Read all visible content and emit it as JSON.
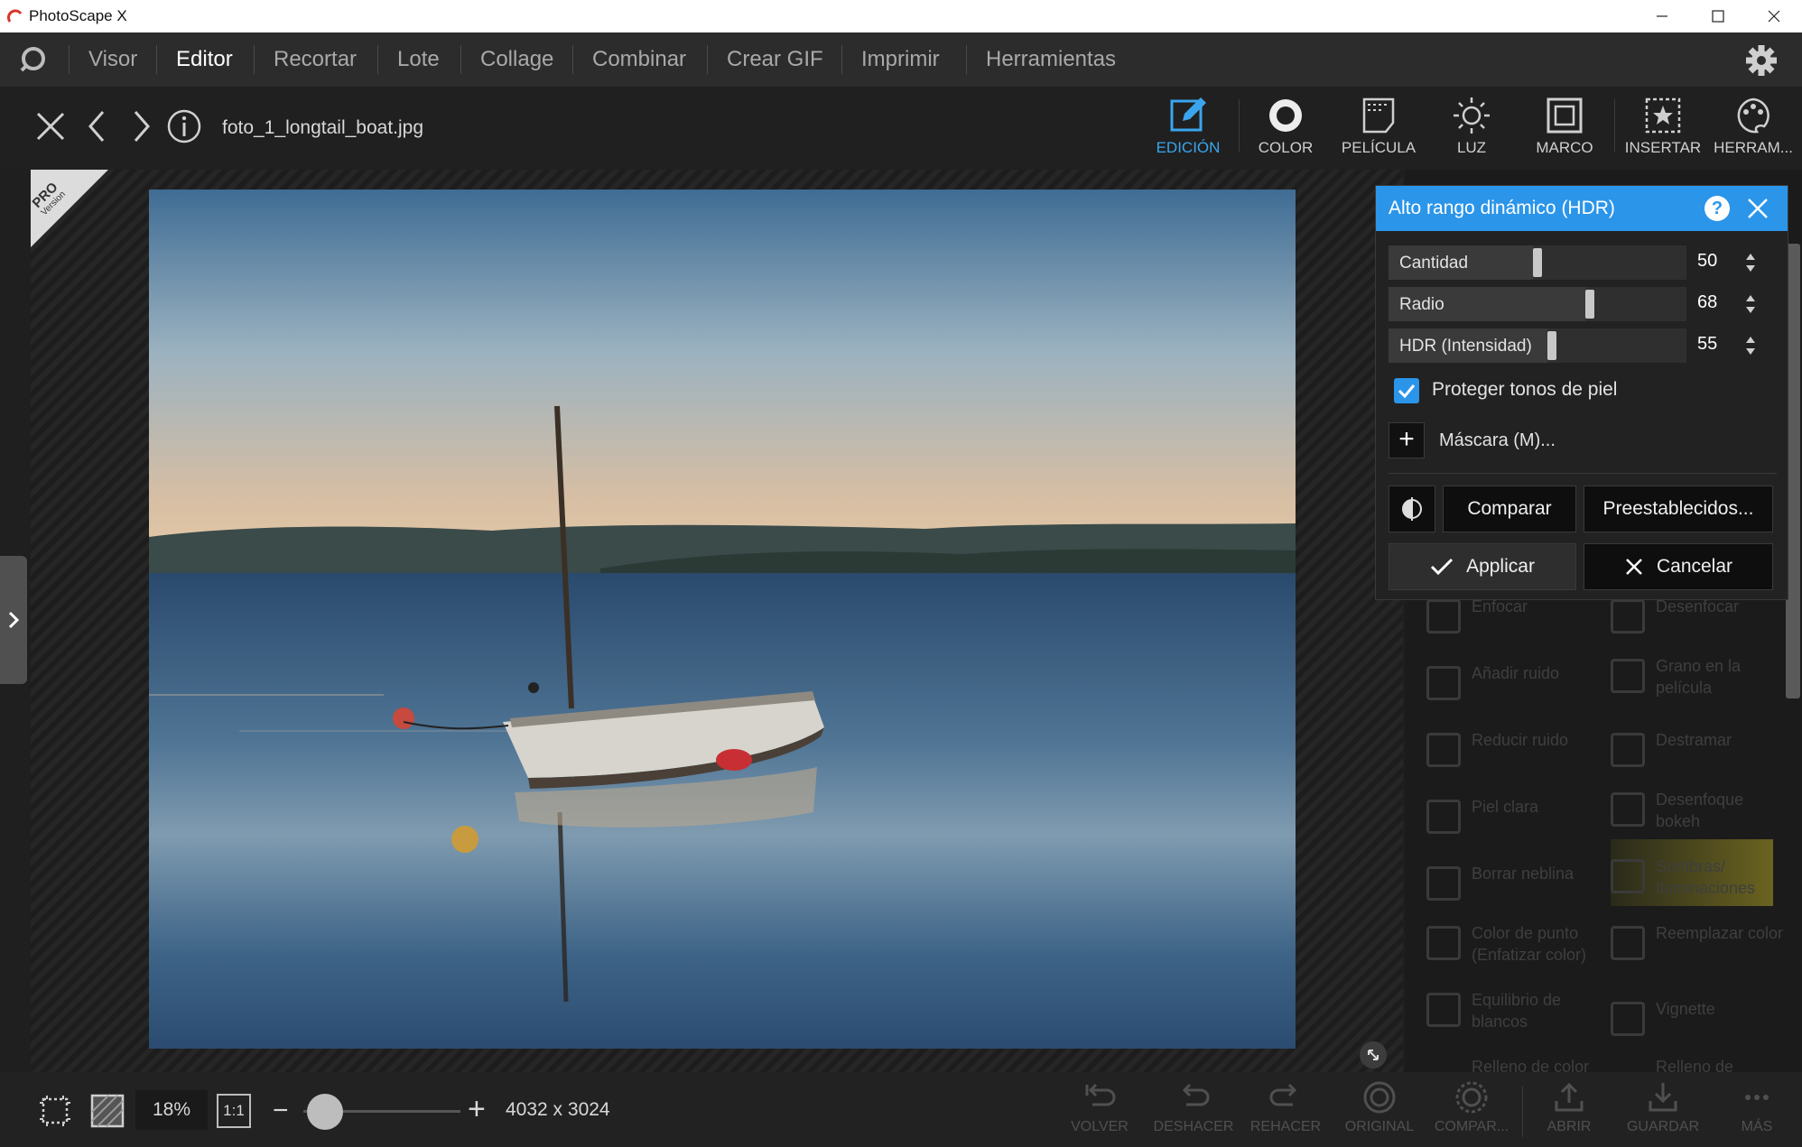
{
  "window": {
    "title": "PhotoScape X"
  },
  "menu": {
    "items": [
      {
        "label": "Visor"
      },
      {
        "label": "Editor"
      },
      {
        "label": "Recortar"
      },
      {
        "label": "Lote"
      },
      {
        "label": "Collage"
      },
      {
        "label": "Combinar"
      },
      {
        "label": "Crear GIF"
      },
      {
        "label": "Imprimir"
      },
      {
        "label": "Herramientas"
      }
    ],
    "active_index": 1
  },
  "toolbar": {
    "filename": "foto_1_longtail_boat.jpg",
    "tools": [
      {
        "label": "EDICIÓN",
        "icon": "pencil-edit-icon"
      },
      {
        "label": "COLOR",
        "icon": "color-circle-icon"
      },
      {
        "label": "PELÍCULA",
        "icon": "film-icon"
      },
      {
        "label": "LUZ",
        "icon": "sun-icon"
      },
      {
        "label": "MARCO",
        "icon": "frame-icon"
      },
      {
        "label": "INSERTAR",
        "icon": "insert-star-icon"
      },
      {
        "label": "HERRAM...",
        "icon": "palette-tools-icon"
      }
    ]
  },
  "badge": {
    "line1": "PRO",
    "line2": "Version"
  },
  "hdr_dialog": {
    "title": "Alto rango dinámico (HDR)",
    "sliders": [
      {
        "label": "Cantidad",
        "value": "50",
        "fraction": 0.5
      },
      {
        "label": "Radio",
        "value": "68",
        "fraction": 0.68
      },
      {
        "label": "HDR (Intensidad)",
        "value": "55",
        "fraction": 0.55
      }
    ],
    "protect_skin": {
      "label": "Proteger tonos de piel",
      "checked": true
    },
    "mask_label": "Máscara (M)...",
    "compare_label": "Comparar",
    "presets_label": "Preestablecidos...",
    "apply_label": "Applicar",
    "cancel_label": "Cancelar"
  },
  "panel_tools": [
    {
      "label": "Enfocar"
    },
    {
      "label": "Desenfocar"
    },
    {
      "label": "Añadir ruido"
    },
    {
      "label": "Grano en la película"
    },
    {
      "label": "Reducir ruido"
    },
    {
      "label": "Destramar"
    },
    {
      "label": "Piel clara"
    },
    {
      "label": "Desenfoque bokeh"
    },
    {
      "label": "Borrar neblina"
    },
    {
      "label": "Sombras/ Iluminaciones"
    },
    {
      "label": "Color de punto (Enfatizar color)"
    },
    {
      "label": "Reemplazar color"
    },
    {
      "label": "Equilibrio de blancos"
    },
    {
      "label": "Vignette"
    },
    {
      "label": "Relleno de color"
    },
    {
      "label": "Relleno de"
    }
  ],
  "bottom": {
    "zoom": "18%",
    "one_to_one": "1:1",
    "dimensions": "4032 x 3024",
    "actions": [
      {
        "label": "VOLVER"
      },
      {
        "label": "DESHACER"
      },
      {
        "label": "REHACER"
      },
      {
        "label": "ORIGINAL"
      },
      {
        "label": "COMPAR..."
      },
      {
        "label": "ABRIR"
      },
      {
        "label": "GUARDAR"
      },
      {
        "label": "MÁS"
      }
    ]
  },
  "colors": {
    "accent": "#2b95e9",
    "bg": "#1f1f1f"
  }
}
